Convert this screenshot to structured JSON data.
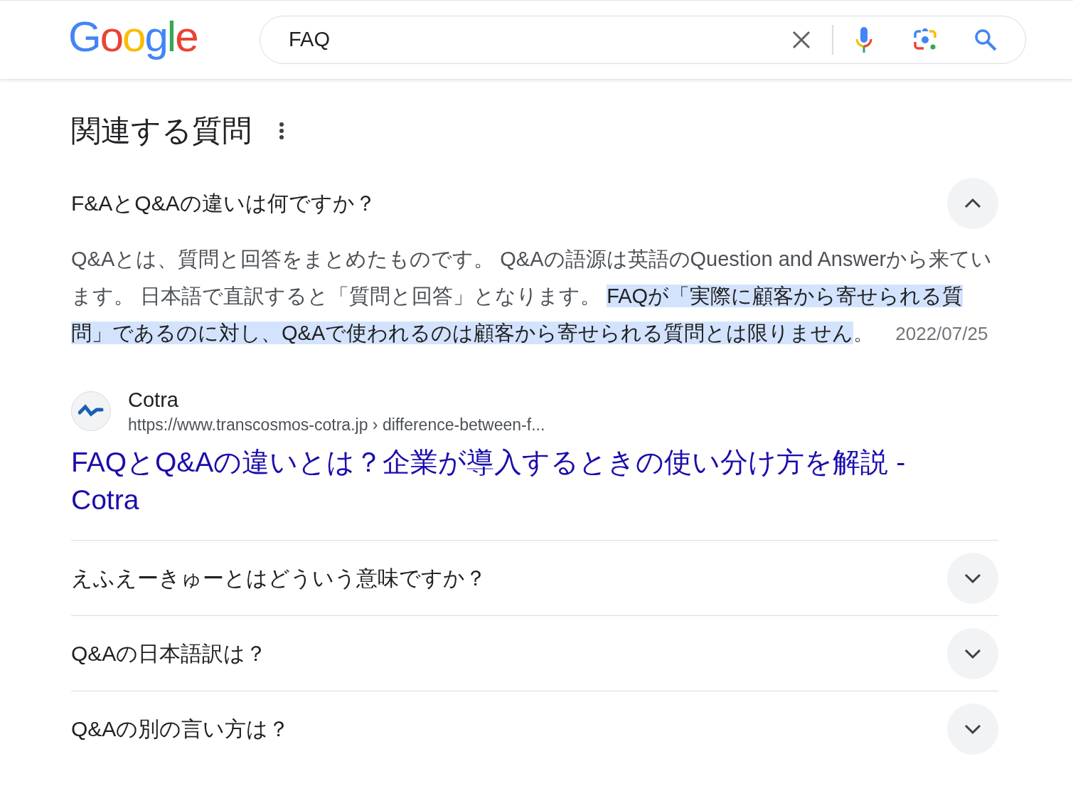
{
  "header": {
    "logo": "Google",
    "search": {
      "value": "FAQ"
    }
  },
  "section": {
    "title": "関連する質問"
  },
  "questions": [
    {
      "question": "F&AとQ&Aの違いは何ですか？",
      "expanded": true,
      "answer_parts": [
        {
          "text": "Q&Aとは、質問と回答をまとめたものです。 Q&Aの語源は英語のQuestion and Answerから来ています。 日本語で直訳すると「質問と回答」となります。 ",
          "highlighted": false
        },
        {
          "text": "FAQが「実際に顧客から寄せられる質問」であるのに対し、Q&Aで使われるのは顧客から寄せられる質問とは限りません",
          "highlighted": true
        },
        {
          "text": "。",
          "highlighted": false
        }
      ],
      "date": "2022/07/25",
      "source": {
        "site": "Cotra",
        "url": "https://www.transcosmos-cotra.jp › difference-between-f...",
        "title": "FAQとQ&Aの違いとは？企業が導入するときの使い分け方を解説 - Cotra"
      }
    },
    {
      "question": "えふえーきゅーとはどういう意味ですか？",
      "expanded": false
    },
    {
      "question": "Q&Aの日本語訳は？",
      "expanded": false
    },
    {
      "question": "Q&Aの別の言い方は？",
      "expanded": false
    }
  ]
}
